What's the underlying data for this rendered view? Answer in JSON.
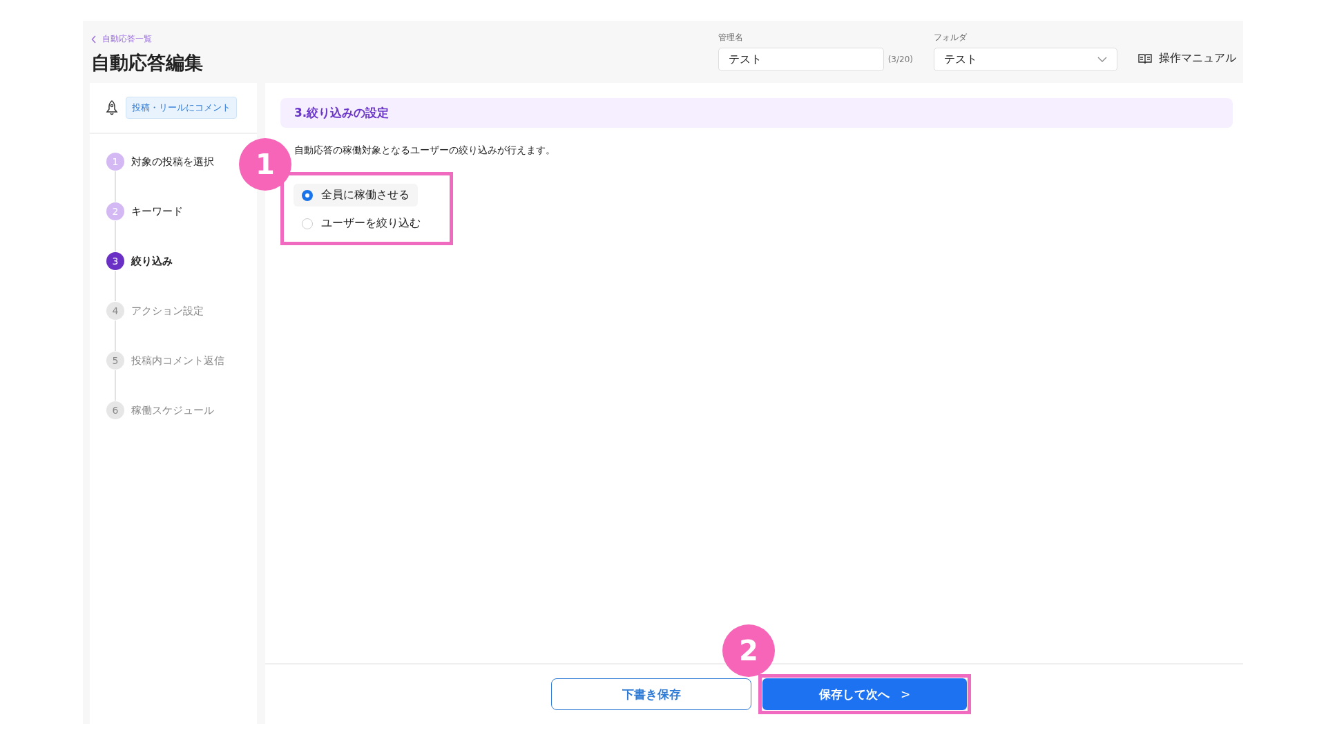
{
  "header": {
    "breadcrumb": "自動応答一覧",
    "title": "自動応答編集",
    "name_field": {
      "label": "管理名",
      "value": "テスト",
      "counter": "(3/20)"
    },
    "folder_field": {
      "label": "フォルダ",
      "value": "テスト"
    },
    "manual_link": "操作マニュアル"
  },
  "sidebar": {
    "trigger_tag": "投稿・リールにコメント",
    "steps": [
      {
        "number": "1",
        "label": "対象の投稿を選択",
        "kind": "done"
      },
      {
        "number": "2",
        "label": "キーワード",
        "kind": "done"
      },
      {
        "number": "3",
        "label": "絞り込み",
        "kind": "current"
      },
      {
        "number": "4",
        "label": "アクション設定",
        "kind": "pending"
      },
      {
        "number": "5",
        "label": "投稿内コメント返信",
        "kind": "pending"
      },
      {
        "number": "6",
        "label": "稼働スケジュール",
        "kind": "pending"
      }
    ]
  },
  "main": {
    "section_title": "3.絞り込みの設定",
    "description": "自動応答の稼働対象となるユーザーの絞り込みが行えます。",
    "options": [
      {
        "label": "全員に稼働させる",
        "selected": true
      },
      {
        "label": "ユーザーを絞り込む",
        "selected": false
      }
    ]
  },
  "footer": {
    "draft_button": "下書き保存",
    "next_button": "保存して次へ",
    "next_arrow": ">"
  },
  "annotations": [
    {
      "label": "1"
    },
    {
      "label": "2"
    }
  ]
}
